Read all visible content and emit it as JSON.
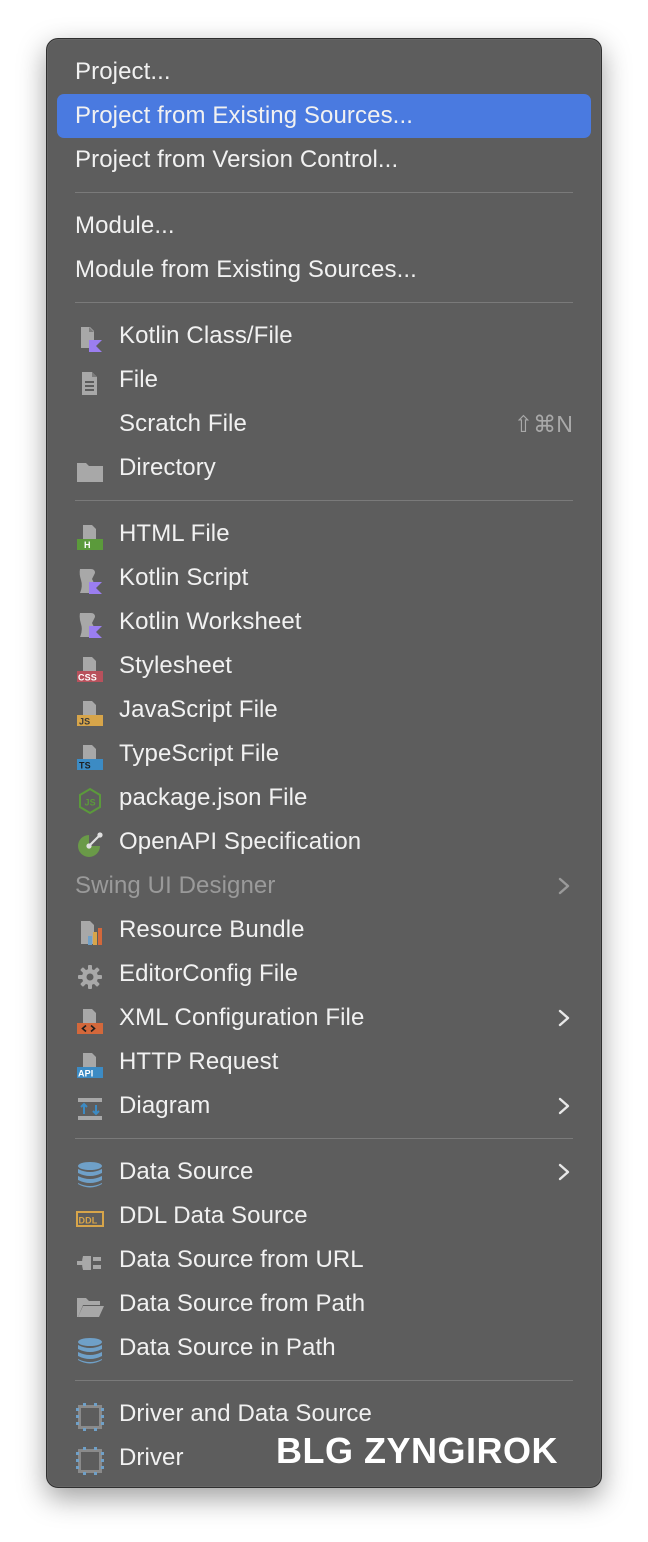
{
  "menu": {
    "items": {
      "project": {
        "label": "Project..."
      },
      "project_existing": {
        "label": "Project from Existing Sources..."
      },
      "project_vcs": {
        "label": "Project from Version Control..."
      },
      "module": {
        "label": "Module..."
      },
      "module_existing": {
        "label": "Module from Existing Sources..."
      },
      "kotlin_class": {
        "label": "Kotlin Class/File",
        "icon": "kotlin-class-icon"
      },
      "file": {
        "label": "File",
        "icon": "file-icon"
      },
      "scratch": {
        "label": "Scratch File",
        "shortcut": "⇧⌘N"
      },
      "directory": {
        "label": "Directory",
        "icon": "folder-icon"
      },
      "html_file": {
        "label": "HTML File",
        "icon": "html-file-icon"
      },
      "kotlin_script": {
        "label": "Kotlin Script",
        "icon": "kotlin-script-icon"
      },
      "kotlin_worksheet": {
        "label": "Kotlin Worksheet",
        "icon": "kotlin-worksheet-icon"
      },
      "stylesheet": {
        "label": "Stylesheet",
        "icon": "css-file-icon"
      },
      "javascript": {
        "label": "JavaScript File",
        "icon": "js-file-icon"
      },
      "typescript": {
        "label": "TypeScript File",
        "icon": "ts-file-icon"
      },
      "package_json": {
        "label": "package.json File",
        "icon": "nodejs-icon"
      },
      "openapi": {
        "label": "OpenAPI Specification",
        "icon": "openapi-icon"
      },
      "swing": {
        "label": "Swing UI Designer"
      },
      "resource_bundle": {
        "label": "Resource Bundle",
        "icon": "resource-bundle-icon"
      },
      "editorconfig": {
        "label": "EditorConfig File",
        "icon": "gear-icon"
      },
      "xml_config": {
        "label": "XML Configuration File",
        "icon": "xml-file-icon"
      },
      "http_request": {
        "label": "HTTP Request",
        "icon": "api-file-icon"
      },
      "diagram": {
        "label": "Diagram",
        "icon": "diagram-icon"
      },
      "data_source": {
        "label": "Data Source",
        "icon": "database-icon"
      },
      "ddl_source": {
        "label": "DDL Data Source",
        "icon": "ddl-icon"
      },
      "ds_url": {
        "label": "Data Source from URL",
        "icon": "plug-icon"
      },
      "ds_path": {
        "label": "Data Source from Path",
        "icon": "open-folder-icon"
      },
      "ds_in_path": {
        "label": "Data Source in Path",
        "icon": "database-icon"
      },
      "driver_ds": {
        "label": "Driver and Data Source",
        "icon": "driver-icon"
      },
      "driver": {
        "label": "Driver",
        "icon": "driver-icon"
      }
    }
  },
  "watermark": "BLG ZYNGIROK",
  "colors": {
    "menu_bg": "#5d5d5d",
    "selection": "#4a7ae0",
    "text": "#f1f1f1",
    "disabled_text": "#9a9a9a",
    "kotlin_purple": "#9b7ef0",
    "html_green": "#5b9a3b",
    "css_red": "#b8515c",
    "js_yellow": "#d7a54a",
    "ts_blue": "#3c8bc4",
    "xml_orange": "#d3683b",
    "db_blue": "#6fa0c8"
  }
}
